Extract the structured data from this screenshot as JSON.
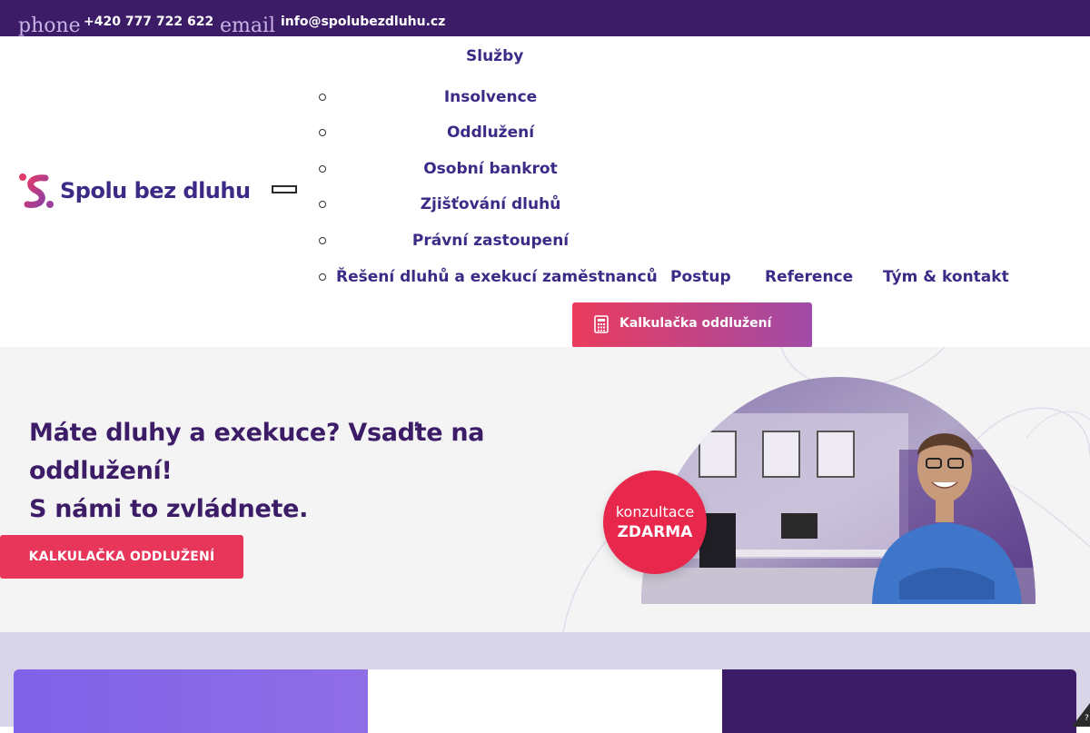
{
  "topbar": {
    "phone_alt": "phone",
    "phone_number": "+420 777 722 622",
    "email_alt": "email",
    "email_address": "info@spolubezdluhu.cz"
  },
  "brand": {
    "name": "Spolu bez dluhu"
  },
  "nav": {
    "services_label": "Služby",
    "services_submenu": [
      "Insolvence",
      "Oddlužení",
      "Osobní bankrot",
      "Zjišťování dluhů",
      "Právní zastoupení",
      "Řešení dluhů a exekucí zaměstnanců"
    ],
    "items": [
      "Postup",
      "Reference",
      "Tým & kontakt"
    ],
    "calculator_button": "Kalkulačka oddlužení"
  },
  "hero": {
    "title_line1": "Máte dluhy a exekuce? Vsaďte na oddlužení!",
    "title_line2": "S námi to zvládnete.",
    "cta_label": "KALKULAČKA ODDLUŽENÍ",
    "badge_line1": "konzultace",
    "badge_line2": "ZDARMA"
  },
  "colors": {
    "primary": "#3d1c67",
    "accent": "#e8365a",
    "brand_text": "#3d2a87"
  }
}
